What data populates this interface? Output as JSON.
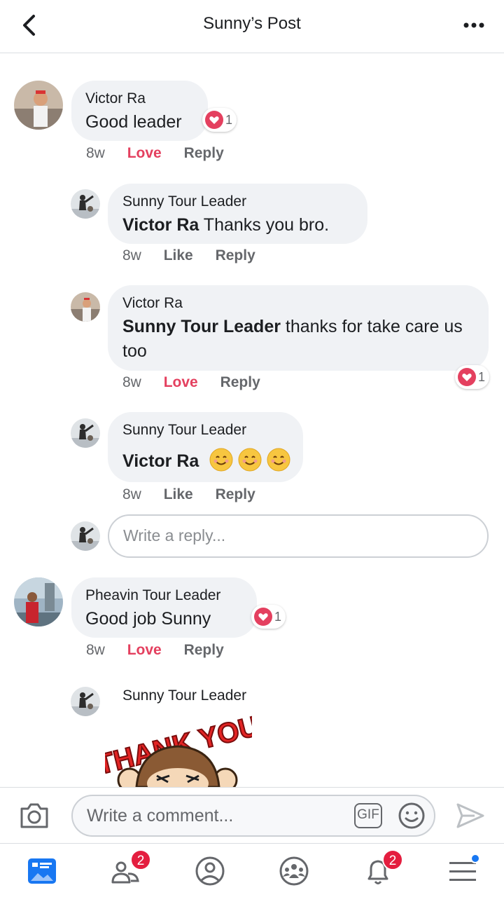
{
  "header": {
    "title": "Sunny’s Post"
  },
  "comments": [
    {
      "name": "Victor Ra",
      "text": "Good leader",
      "time": "8w",
      "action": "Love",
      "reply": "Reply",
      "reactions": "1"
    },
    {
      "name": "Sunny Tour Leader",
      "mention": "Victor Ra",
      "text": " Thanks you bro.",
      "time": "8w",
      "action": "Like",
      "reply": "Reply"
    },
    {
      "name": "Victor Ra",
      "mention": "Sunny Tour Leader",
      "text": " thanks for take care us too",
      "time": "8w",
      "action": "Love",
      "reply": "Reply",
      "reactions": "1"
    },
    {
      "name": "Sunny Tour Leader",
      "mention": "Victor Ra",
      "text": "",
      "time": "8w",
      "action": "Like",
      "reply": "Reply"
    },
    {
      "name": "Pheavin Tour Leader",
      "text": "Good job Sunny",
      "time": "8w",
      "action": "Love",
      "reply": "Reply",
      "reactions": "1"
    },
    {
      "name": "Sunny Tour Leader",
      "sticker_text": "THANK YOU"
    }
  ],
  "reply_box": {
    "placeholder": "Write a reply..."
  },
  "composer": {
    "placeholder": "Write a comment...",
    "gif_label": "GIF"
  },
  "tabbar": {
    "friends_badge": "2",
    "notifications_badge": "2"
  },
  "colors": {
    "love": "#e4405f",
    "badge": "#e41e3f",
    "accent": "#1877f2"
  }
}
